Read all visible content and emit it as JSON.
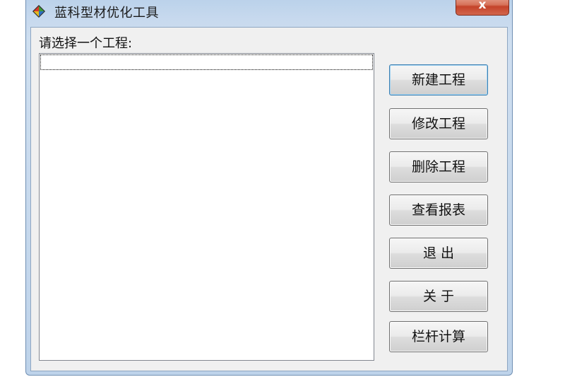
{
  "window": {
    "title": "蓝科型材优化工具",
    "close_label": "x",
    "app_icon": "diamond-app-icon"
  },
  "main": {
    "prompt_label": "请选择一个工程:",
    "project_list": {
      "items": []
    }
  },
  "buttons": {
    "new_project": "新建工程",
    "edit_project": "修改工程",
    "delete_project": "删除工程",
    "view_report": "查看报表",
    "exit": "退 出",
    "about": "关 于",
    "railing_calc": "栏杆计算"
  },
  "colors": {
    "title_bar": "#c7d9ee",
    "close_button": "#c4432a",
    "client_bg": "#f0f0f0",
    "default_button_border": "#3c7fb1"
  }
}
